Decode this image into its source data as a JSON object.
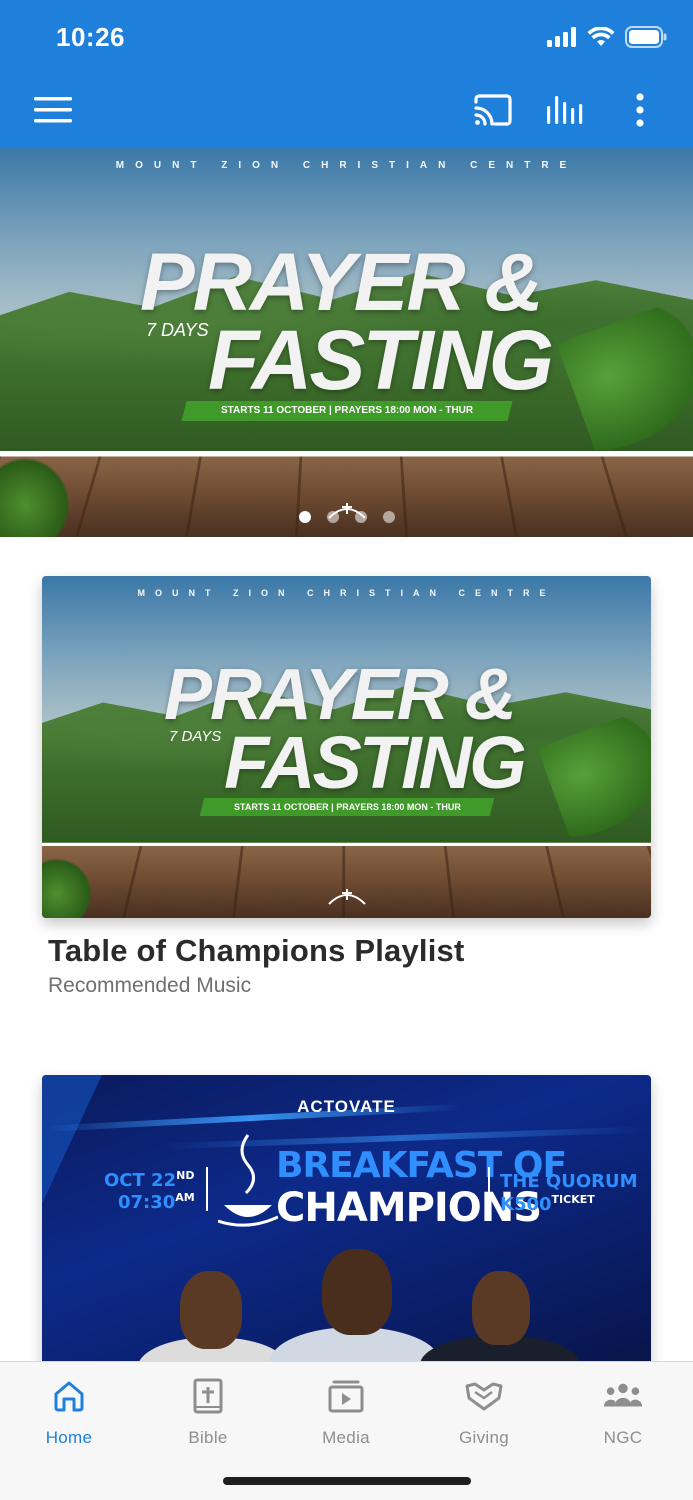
{
  "status_bar": {
    "time": "10:26"
  },
  "app_bar": {
    "background": "#1f80dc",
    "actions": [
      {
        "name": "menu",
        "icon": "hamburger-icon"
      },
      {
        "name": "cast",
        "icon": "cast-icon"
      },
      {
        "name": "audio",
        "icon": "equalizer-icon"
      },
      {
        "name": "more",
        "icon": "more-vertical-icon"
      }
    ]
  },
  "hero": {
    "organization": "MOUNT ZION CHRISTIAN CENTRE",
    "title_line1": "PRAYER &",
    "days": "7 DAYS",
    "title_line2": "FASTING",
    "strip_text": "STARTS 11 OCTOBER  |  PRAYERS 18:00 MON - THUR",
    "carousel": {
      "count": 4,
      "active_index": 0
    }
  },
  "cards": [
    {
      "title": "Table of Champions Playlist",
      "subtitle": "Recommended Music",
      "artwork": {
        "organization": "MOUNT ZION CHRISTIAN CENTRE",
        "title_line1": "PRAYER &",
        "days": "7 DAYS",
        "title_line2": "FASTING",
        "strip_text": "STARTS 11 OCTOBER  |  PRAYERS 18:00 MON - THUR"
      }
    },
    {
      "artwork": {
        "brand": "ACTOVATE",
        "title_line1": "BREAKFAST OF",
        "title_line2": "CHAMPIONS",
        "date": "OCT 22",
        "date_suffix": "ND",
        "time": "07:30",
        "time_suffix": "AM",
        "venue": "THE QUORUM",
        "price": "K500",
        "price_suffix": "TICKET"
      }
    }
  ],
  "bottom_nav": {
    "active": "home",
    "accent": "#1f80dc",
    "items": [
      {
        "key": "home",
        "label": "Home",
        "icon": "home-icon"
      },
      {
        "key": "bible",
        "label": "Bible",
        "icon": "bible-icon"
      },
      {
        "key": "media",
        "label": "Media",
        "icon": "media-icon"
      },
      {
        "key": "giving",
        "label": "Giving",
        "icon": "giving-icon"
      },
      {
        "key": "ngc",
        "label": "NGC",
        "icon": "group-icon"
      }
    ]
  }
}
